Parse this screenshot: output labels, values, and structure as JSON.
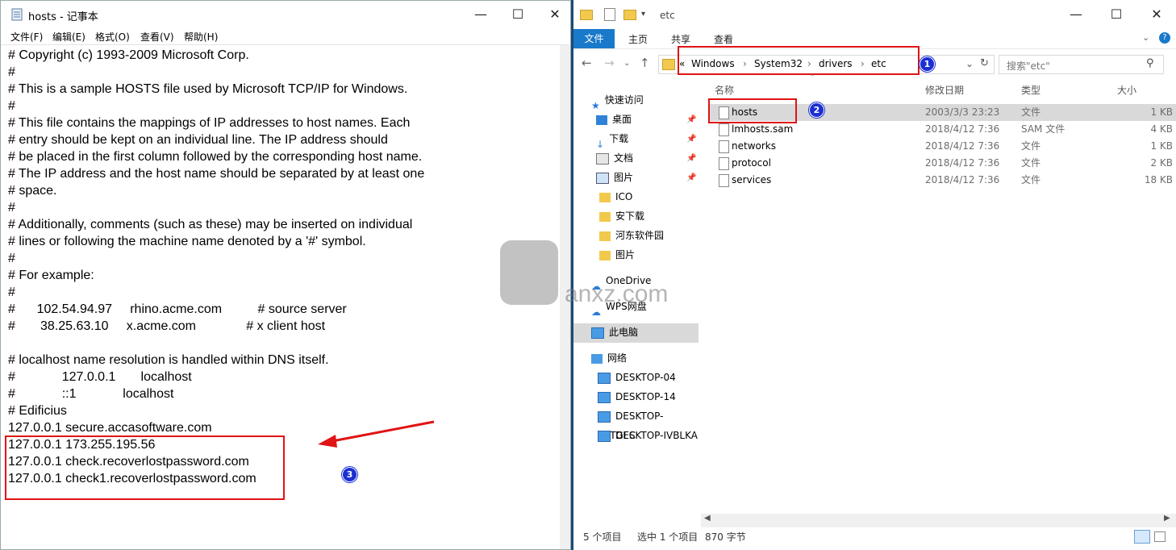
{
  "notepad": {
    "title": "hosts - 记事本",
    "menu": [
      "文件(F)",
      "编辑(E)",
      "格式(O)",
      "查看(V)",
      "帮助(H)"
    ],
    "lines": [
      "# Copyright (c) 1993-2009 Microsoft Corp.",
      "#",
      "# This is a sample HOSTS file used by Microsoft TCP/IP for Windows.",
      "#",
      "# This file contains the mappings of IP addresses to host names. Each",
      "# entry should be kept on an individual line. The IP address should",
      "# be placed in the first column followed by the corresponding host name.",
      "# The IP address and the host name should be separated by at least one",
      "# space.",
      "#",
      "# Additionally, comments (such as these) may be inserted on individual",
      "# lines or following the machine name denoted by a '#' symbol.",
      "#",
      "# For example:",
      "#",
      "#      102.54.94.97     rhino.acme.com          # source server",
      "#       38.25.63.10     x.acme.com              # x client host",
      "",
      "# localhost name resolution is handled within DNS itself.",
      "#             127.0.0.1       localhost",
      "#             ::1             localhost",
      "# Edificius",
      "127.0.0.1 secure.accasoftware.com",
      "127.0.0.1 173.255.195.56",
      "127.0.0.1 check.recoverlostpassword.com",
      "127.0.0.1 check1.recoverlostpassword.com"
    ]
  },
  "explorer": {
    "title": "etc",
    "tabs": [
      "文件",
      "主页",
      "共享",
      "查看"
    ],
    "breadcrumb": [
      "Windows",
      "System32",
      "drivers",
      "etc"
    ],
    "search_placeholder": "搜索\"etc\"",
    "columns": [
      "名称",
      "修改日期",
      "类型",
      "大小"
    ],
    "files": [
      {
        "name": "hosts",
        "date": "2003/3/3 23:23",
        "type": "文件",
        "size": "1 KB"
      },
      {
        "name": "lmhosts.sam",
        "date": "2018/4/12 7:36",
        "type": "SAM 文件",
        "size": "4 KB"
      },
      {
        "name": "networks",
        "date": "2018/4/12 7:36",
        "type": "文件",
        "size": "1 KB"
      },
      {
        "name": "protocol",
        "date": "2018/4/12 7:36",
        "type": "文件",
        "size": "2 KB"
      },
      {
        "name": "services",
        "date": "2018/4/12 7:36",
        "type": "文件",
        "size": "18 KB"
      }
    ],
    "nav": {
      "quick_access": "快速访问",
      "pinned": [
        "桌面",
        "下载",
        "文档",
        "图片"
      ],
      "folders": [
        "ICO",
        "安下载",
        "河东软件园",
        "图片"
      ],
      "onedrive": "OneDrive",
      "wps": "WPS网盘",
      "this_pc": "此电脑",
      "network": "网络",
      "computers": [
        "DESKTOP-04",
        "DESKTOP-14",
        "DESKTOP-7ETGFC",
        "DESKTOP-IVBLKA"
      ]
    },
    "status": {
      "count": "5 个项目",
      "selected": "选中 1 个项目",
      "size": "870 字节"
    }
  },
  "annotations": {
    "badges": [
      "1",
      "2",
      "3"
    ],
    "watermark": "anxz.com"
  },
  "colors": {
    "accent": "#1979ca",
    "highlight": "#e01414",
    "badge": "#1b2fd3"
  }
}
